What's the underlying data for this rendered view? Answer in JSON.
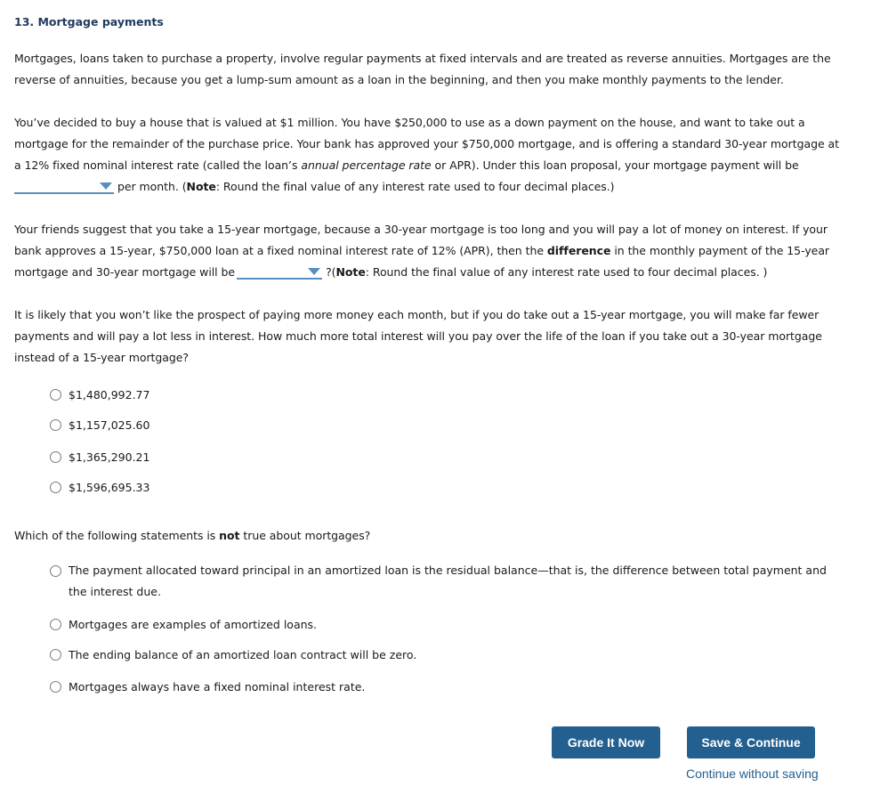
{
  "question": {
    "title": "13. Mortgage payments"
  },
  "intro": {
    "text": "Mortgages, loans taken to purchase a property, involve regular payments at fixed intervals and are treated as reverse annuities. Mortgages are the reverse of annuities, because you get a lump-sum amount as a loan in the beginning, and then you make monthly payments to the lender."
  },
  "part1": {
    "text_a": "You’ve decided to buy a house that is valued at $1 million. You have $250,000 to use as a down payment on the house, and want to take out a mortgage for the remainder of the purchase price. Your bank has approved your $750,000 mortgage, and is offering a standard 30-year mortgage at a 12% fixed nominal interest rate (called the loan’s ",
    "text_italic": "annual percentage rate",
    "text_b": " or APR). Under this loan proposal, your mortgage payment will be",
    "dropdown_value": "",
    "text_c": "per month. (",
    "note_label": "Note",
    "text_d": ": Round the final value of any interest rate used to four decimal places.)"
  },
  "part2": {
    "text_a": "Your friends suggest that you take a 15-year mortgage, because a 30-year mortgage is too long and you will pay a lot of money on interest. If your bank approves a 15-year, $750,000 loan at a fixed nominal interest rate of 12% (APR), then the ",
    "text_bold": "difference",
    "text_b": " in the monthly payment of the 15-year mortgage and 30-year mortgage will be",
    "dropdown_value": "",
    "text_c": "?(",
    "note_label": "Note",
    "text_d": ": Round the final value of any interest rate used to four decimal places. )"
  },
  "part3": {
    "text": "It is likely that you won’t like the prospect of paying more money each month, but if you do take out a 15-year mortgage, you will make far fewer payments and will pay a lot less in interest. How much more total interest will you pay over the life of the loan if you take out a 30-year mortgage instead of a 15-year mortgage?",
    "options": [
      {
        "label": "$1,480,992.77",
        "selected": false
      },
      {
        "label": "$1,157,025.60",
        "selected": false
      },
      {
        "label": "$1,365,290.21",
        "selected": false
      },
      {
        "label": "$1,596,695.33",
        "selected": false
      }
    ]
  },
  "part4": {
    "text_a": "Which of the following statements is ",
    "text_bold": "not",
    "text_b": " true about mortgages?",
    "options": [
      {
        "label": "The payment allocated toward principal in an amortized loan is the residual balance—that is, the difference between total payment and the interest due.",
        "selected": false
      },
      {
        "label": "Mortgages are examples of amortized loans.",
        "selected": false
      },
      {
        "label": "The ending balance of an amortized loan contract will be zero.",
        "selected": false
      },
      {
        "label": "Mortgages always have a fixed nominal interest rate.",
        "selected": false
      }
    ]
  },
  "actions": {
    "grade_label": "Grade It Now",
    "save_label": "Save & Continue",
    "continue_label": "Continue without saving"
  },
  "colors": {
    "title": "#1f3a5f",
    "accent": "#24608f",
    "dropdown": "#5a8ec0"
  }
}
